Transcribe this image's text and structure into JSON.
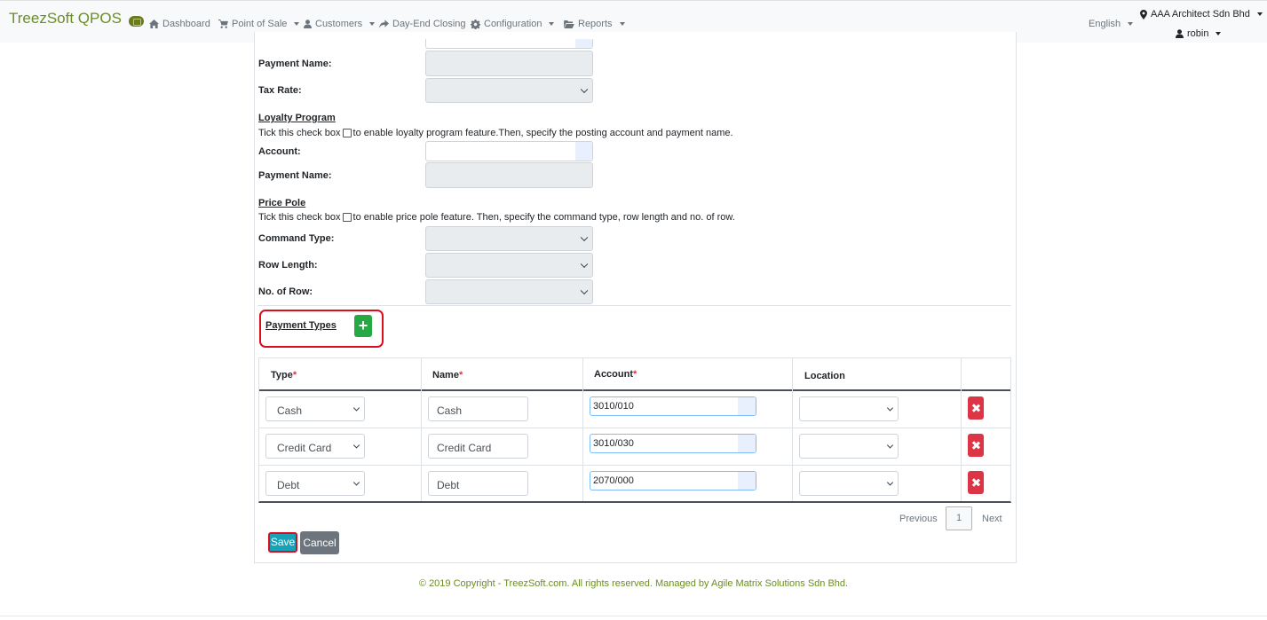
{
  "navbar": {
    "brand": "TreezSoft QPOS",
    "items": [
      {
        "label": "Dashboard",
        "icon": "home-icon"
      },
      {
        "label": "Point of Sale",
        "icon": "cart-icon"
      },
      {
        "label": "Customers",
        "icon": "user-icon"
      },
      {
        "label": "Day-End Closing",
        "icon": "share-icon"
      },
      {
        "label": "Configuration",
        "icon": "gear-icon"
      },
      {
        "label": "Reports",
        "icon": "folder-icon"
      }
    ],
    "language": "English",
    "company": "AAA Architect Sdn Bhd",
    "user": "robin"
  },
  "form": {
    "payment_name_label": "Payment Name:",
    "tax_rate_label": "Tax Rate:",
    "loyalty": {
      "title": "Loyalty Program",
      "desc_before": "Tick this check box",
      "desc_after": " to enable loyalty program feature.Then, specify the posting account and payment name.",
      "account_label": "Account:",
      "payment_name_label": "Payment Name:"
    },
    "price_pole": {
      "title": "Price Pole",
      "desc_before": "Tick this check box",
      "desc_after": " to enable price pole feature. Then, specify the command type, row length and no. of row.",
      "command_type_label": "Command Type:",
      "row_length_label": "Row Length:",
      "no_of_row_label": "No. of Row:"
    }
  },
  "payment_types": {
    "title": "Payment Types",
    "add_label": "+",
    "columns": {
      "type": "Type",
      "name": "Name",
      "account": "Account",
      "location": "Location",
      "required_mark": "*"
    },
    "rows": [
      {
        "type": "Cash",
        "name": "Cash",
        "account": "3010/010"
      },
      {
        "type": "Credit Card",
        "name": "Credit Card",
        "account": "3010/030"
      },
      {
        "type": "Debt",
        "name": "Debt",
        "account": "2070/000"
      }
    ]
  },
  "pagination": {
    "previous": "Previous",
    "page": "1",
    "next": "Next"
  },
  "actions": {
    "save": "Save",
    "cancel": "Cancel"
  },
  "footer": "© 2019 Copyright - TreezSoft.com. All rights reserved. Managed by Agile Matrix Solutions Sdn Bhd.",
  "colors": {
    "brand": "#6b8e23",
    "save": "#17a2b8",
    "add": "#28a745",
    "delete": "#dc3545",
    "highlight": "#dc0e1e"
  }
}
